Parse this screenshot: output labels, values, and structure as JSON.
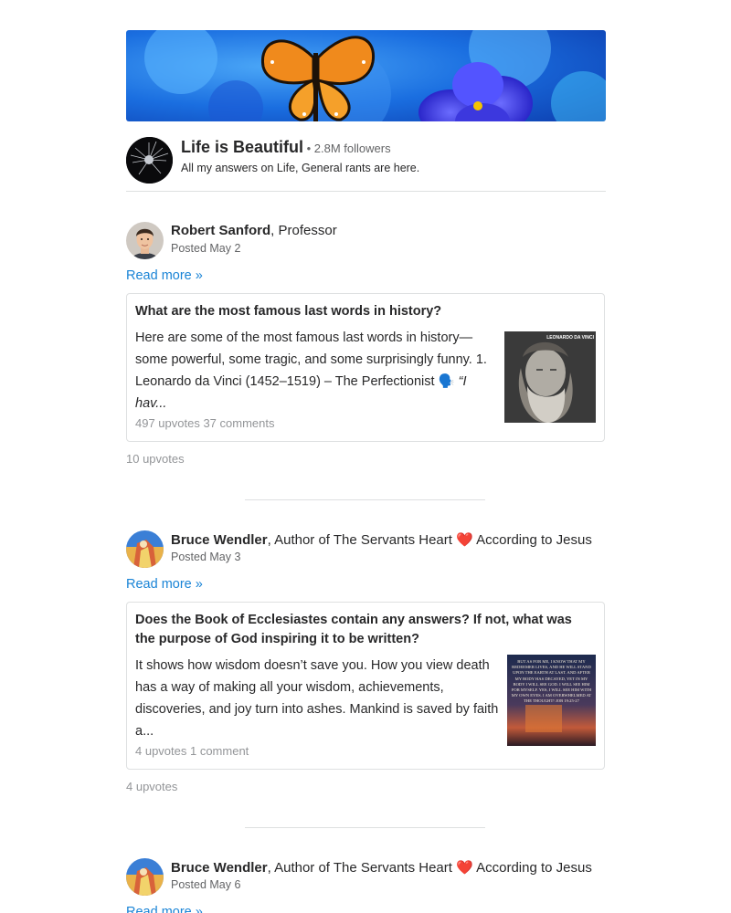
{
  "space": {
    "title": "Life is Beautiful",
    "followers": " • 2.8M followers",
    "description": "All my answers on Life, General rants are here."
  },
  "posts": [
    {
      "author": "Robert Sanford",
      "credential": ", Professor",
      "posted": "Posted May 2",
      "read_more": "Read more »",
      "question": "What are the most famous last words in history?",
      "excerpt": "Here are some of the most famous last words in history—some powerful, some tragic, and some surprisingly funny. 1. Leonardo da Vinci (1452–1519) – The Perfectionist 🗣️ ",
      "excerpt_italic": "“I hav...",
      "stats": "497 upvotes   37 comments",
      "thumb_label": "LEONARDO DA VINCI",
      "upvotes": "10 upvotes"
    },
    {
      "author": "Bruce Wendler",
      "credential": ", Author of The Servants Heart ❤️ According to Jesus",
      "posted": "Posted May 3",
      "read_more": "Read more »",
      "question": "Does the Book of Ecclesiastes contain any answers? If not, what was the purpose of God inspiring it to be written?",
      "excerpt": "It shows how wisdom doesn’t save you. How you view death has a way of making all your wisdom, achievements, discoveries, and joy turn into ashes. Mankind is saved by faith a...",
      "stats": "4 upvotes   1 comment",
      "thumb_label": "BUT AS FOR ME, I KNOW THAT MY REDEEMER LIVES, AND HE WILL STAND UPON THE EARTH AT LAST. AND AFTER MY BODY HAS DECAYED, YET IN MY BODY I WILL SEE GOD. I WILL SEE HIM FOR MYSELF. YES, I WILL SEE HIM WITH MY OWN EYES. I AM OVERWHELMED AT THE THOUGHT! JOB 19:25-27",
      "upvotes": "4 upvotes"
    },
    {
      "author": "Bruce Wendler",
      "credential": ", Author of The Servants Heart ❤️ According to Jesus",
      "posted": "Posted May 6",
      "read_more": "Read more »"
    }
  ]
}
